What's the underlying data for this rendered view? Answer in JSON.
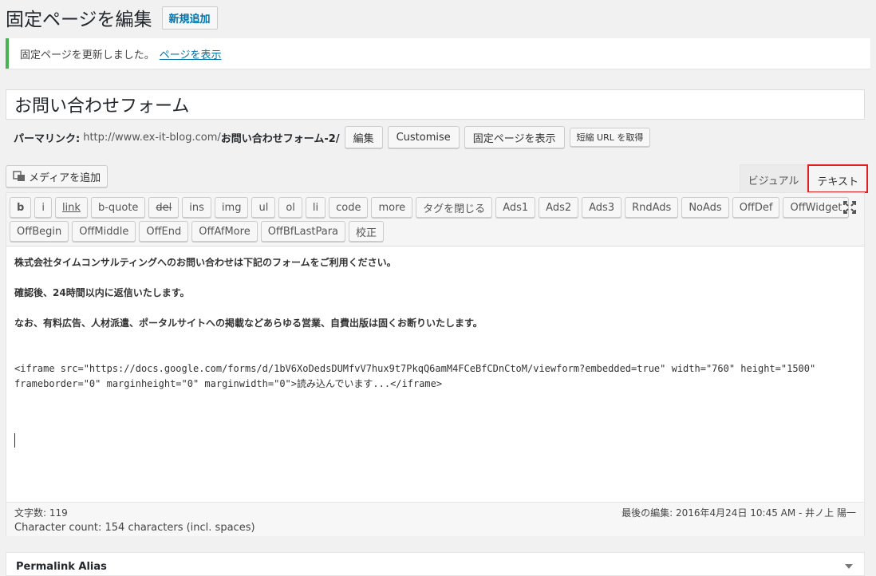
{
  "header": {
    "title": "固定ページを編集",
    "add_new_label": "新規追加"
  },
  "notice": {
    "message": "固定ページを更新しました。",
    "link_label": "ページを表示"
  },
  "post_title": "お問い合わせフォーム",
  "permalink": {
    "label": "パーマリンク:",
    "url_prefix": "http://www.ex-it-blog.com/",
    "slug": "お問い合わせフォーム-2/",
    "edit_label": "編集",
    "customise_label": "Customise",
    "view_label": "固定ページを表示",
    "shortlink_label": "短縮 URL を取得"
  },
  "media_button_label": "メディアを追加",
  "tabs": {
    "visual": "ビジュアル",
    "text": "テキスト"
  },
  "toolbar": {
    "row1": [
      "b",
      "i",
      "link",
      "b-quote",
      "del",
      "ins",
      "img",
      "ul",
      "ol",
      "li",
      "code",
      "more",
      "タグを閉じる",
      "Ads1",
      "Ads2",
      "Ads3",
      "RndAds",
      "NoAds",
      "OffDef",
      "OffWidget"
    ],
    "row2": [
      "OffBegin",
      "OffMiddle",
      "OffEnd",
      "OffAfMore",
      "OffBfLastPara",
      "校正"
    ]
  },
  "content": {
    "line1": "株式会社タイムコンサルティングへのお問い合わせは下記のフォームをご利用ください。",
    "line2": "確認後、24時間以内に返信いたします。",
    "line3": "なお、有料広告、人材派遣、ポータルサイトへの掲載などあらゆる営業、自費出版は固くお断りいたします。",
    "code_line1": "<iframe src=\"https://docs.google.com/forms/d/1bV6XoDedsDUMfvV7hux9t7PkqQ6amM4FCeBfCDnCtoM/viewform?embedded=true\" width=\"760\" height=\"1500\"",
    "code_line2": "frameborder=\"0\" marginheight=\"0\" marginwidth=\"0\">読み込んでいます...</iframe>"
  },
  "status": {
    "word_count": "文字数: 119",
    "last_edit": "最後の編集: 2016年4月24日 10:45 AM - 井ノ上 陽一",
    "char_count": "Character count: 154 characters (incl. spaces)"
  },
  "alias_box": {
    "title": "Permalink Alias"
  },
  "colors": {
    "accent": "#0073aa",
    "notice_border": "#46b450",
    "highlight": "#e02020"
  }
}
